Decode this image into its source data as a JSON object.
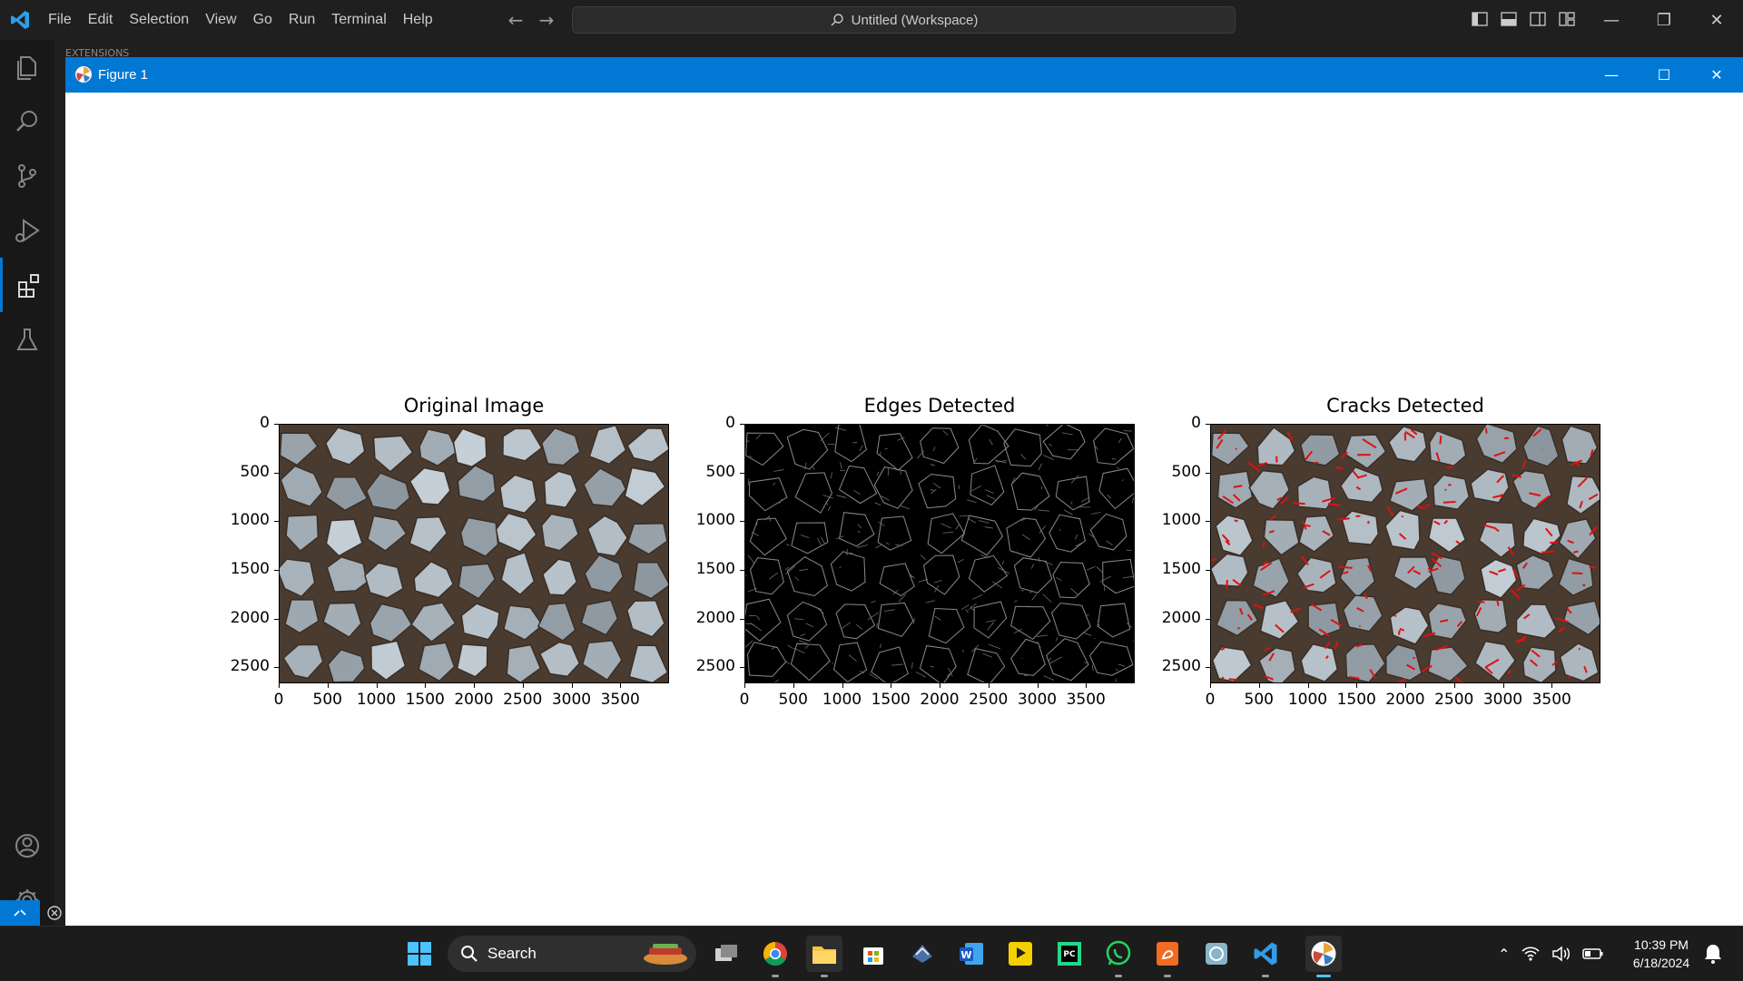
{
  "titlebar": {
    "menu": [
      "File",
      "Edit",
      "Selection",
      "View",
      "Go",
      "Run",
      "Terminal",
      "Help"
    ],
    "command_center": "Untitled (Workspace)"
  },
  "hidden_tabs": "EXTENSIONS",
  "figure_window": {
    "title": "Figure 1",
    "plots": [
      {
        "title": "Original Image",
        "kind": "original"
      },
      {
        "title": "Edges Detected",
        "kind": "edges"
      },
      {
        "title": "Cracks Detected",
        "kind": "cracks"
      }
    ],
    "yticks": [
      "0",
      "500",
      "1000",
      "1500",
      "2000",
      "2500"
    ],
    "xticks": [
      "0",
      "500",
      "1000",
      "1500",
      "2000",
      "2500",
      "3000",
      "3500"
    ]
  },
  "taskbar": {
    "search_label": "Search",
    "apps": [
      "start-icon",
      "search-box",
      "task-view-icon",
      "chrome-icon",
      "file-explorer-icon",
      "store-icon",
      "app-icon",
      "word-icon",
      "player-icon",
      "pycharm-icon",
      "whatsapp-icon",
      "pdf-icon",
      "app2-icon",
      "vscode-icon",
      "python-figure-icon"
    ],
    "time": "10:39 PM",
    "date": "6/18/2024"
  },
  "colors": {
    "accent": "#0078d4",
    "crack_red": "#e01010"
  }
}
